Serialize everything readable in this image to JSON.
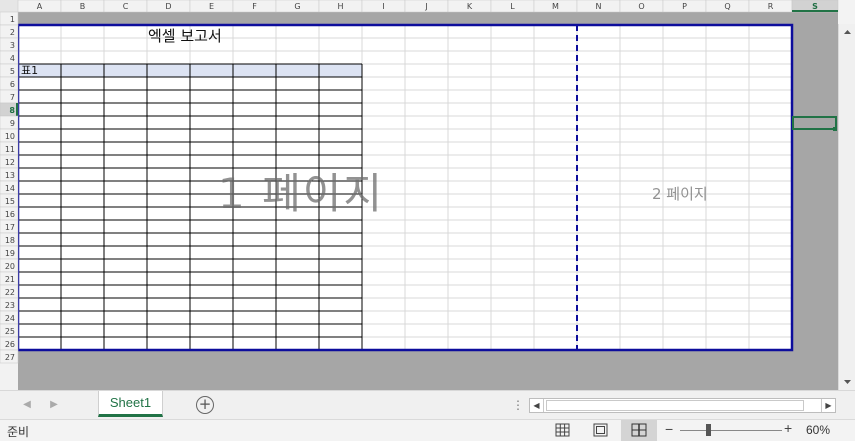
{
  "sheet": {
    "column_headers": [
      "A",
      "B",
      "C",
      "D",
      "E",
      "F",
      "G",
      "H",
      "I",
      "J",
      "K",
      "L",
      "M",
      "N",
      "O",
      "P",
      "Q",
      "R",
      "S"
    ],
    "row_headers": [
      "1",
      "2",
      "3",
      "4",
      "5",
      "6",
      "7",
      "8",
      "9",
      "10",
      "11",
      "12",
      "13",
      "14",
      "15",
      "16",
      "17",
      "18",
      "19",
      "20",
      "21",
      "22",
      "23",
      "24",
      "25",
      "26",
      "27"
    ],
    "selected_cell": "S8",
    "title_cell_text": "엑셀 보고서",
    "table_label": "표1",
    "page1_watermark": "1 페이지",
    "page2_watermark": "2 페이지",
    "colors": {
      "page_border": "#0d0d9c",
      "table_header_fill": "#dce3f3",
      "selection": "#217346",
      "outside_print_area": "#a6a6a6"
    }
  },
  "tabs": {
    "nav_prev_icon": "triangle-left-icon",
    "nav_next_icon": "triangle-right-icon",
    "active_sheet": "Sheet1",
    "add_sheet_icon": "plus-circle-icon"
  },
  "status": {
    "ready_text": "준비",
    "views": [
      "normal-view-icon",
      "page-layout-icon",
      "page-break-preview-icon"
    ],
    "active_view": "page-break-preview-icon",
    "zoom_minus": "−",
    "zoom_plus": "+",
    "zoom_level": "60%"
  }
}
